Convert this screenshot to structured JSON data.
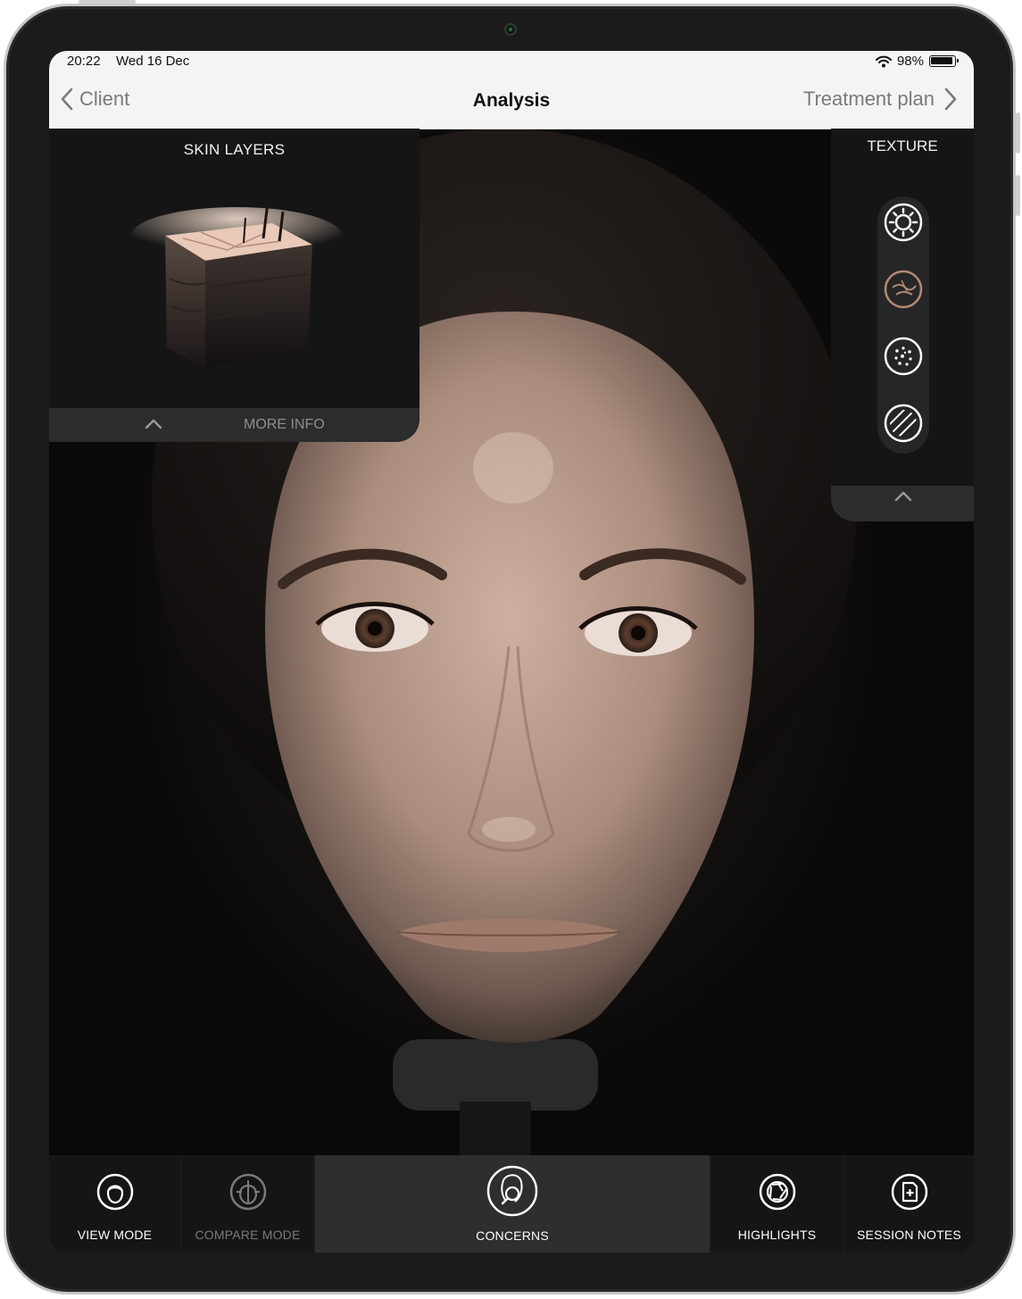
{
  "status_bar": {
    "time": "20:22",
    "date": "Wed 16 Dec",
    "battery": "98%"
  },
  "nav": {
    "back_label": "Client",
    "title": "Analysis",
    "next_label": "Treatment plan"
  },
  "skin_layers": {
    "title": "SKIN LAYERS",
    "more_info_label": "MORE INFO"
  },
  "texture": {
    "title": "TEXTURE",
    "modes": [
      "sun-icon",
      "wrinkle-icon",
      "pores-icon",
      "hatched-circle-icon"
    ],
    "selected_index": 1
  },
  "toolbar": {
    "items": [
      {
        "label": "VIEW MODE",
        "icon": "face-outline-icon",
        "enabled": true
      },
      {
        "label": "COMPARE MODE",
        "icon": "compare-face-icon",
        "enabled": false
      },
      {
        "label": "CONCERNS",
        "icon": "concerns-magnifier-icon",
        "enabled": true,
        "selected": true
      },
      {
        "label": "HIGHLIGHTS",
        "icon": "aperture-icon",
        "enabled": true
      },
      {
        "label": "SESSION NOTES",
        "icon": "note-add-icon",
        "enabled": true
      }
    ]
  },
  "colors": {
    "accent_copper": "#b48a74",
    "panel_bg": "#151515",
    "navbar_bg": "#f4f4f4"
  }
}
